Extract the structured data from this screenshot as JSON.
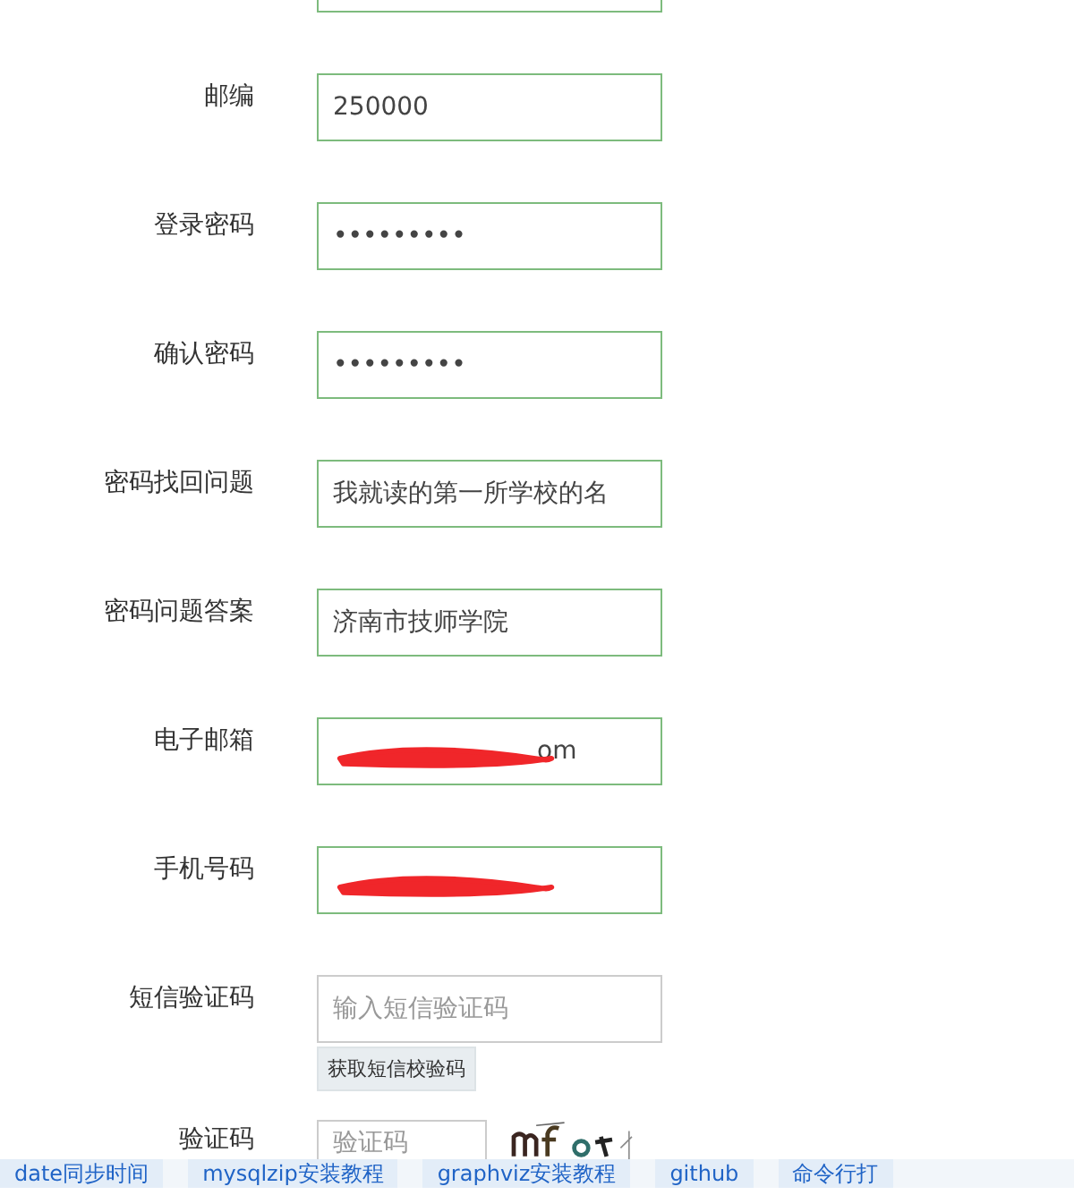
{
  "top_field": {
    "valid": true
  },
  "fields": [
    {
      "label": "邮编",
      "kind": "text",
      "value": "250000",
      "valid": true
    },
    {
      "label": "登录密码",
      "kind": "text",
      "value": "•••••••••",
      "valid": true
    },
    {
      "label": "确认密码",
      "kind": "text",
      "value": "•••••••••",
      "valid": true
    },
    {
      "label": "密码找回问题",
      "kind": "text",
      "value": "我就读的第一所学校的名",
      "valid": true
    },
    {
      "label": "密码问题答案",
      "kind": "text",
      "value": "济南市技师学院",
      "valid": true
    },
    {
      "label": "电子邮箱",
      "kind": "redacted",
      "value": "om",
      "valid": true
    },
    {
      "label": "手机号码",
      "kind": "redacted",
      "valid": true
    },
    {
      "label": "短信验证码",
      "kind": "text",
      "placeholder": "输入短信验证码",
      "valid": false,
      "button": "获取短信校验码"
    }
  ],
  "captcha": {
    "label": "验证码",
    "placeholder": "验证码",
    "valid": false
  },
  "bookmarks": [
    "date同步时间",
    "mysqlzip安装教程",
    "graphviz安装教程",
    "github",
    "命令行打"
  ]
}
